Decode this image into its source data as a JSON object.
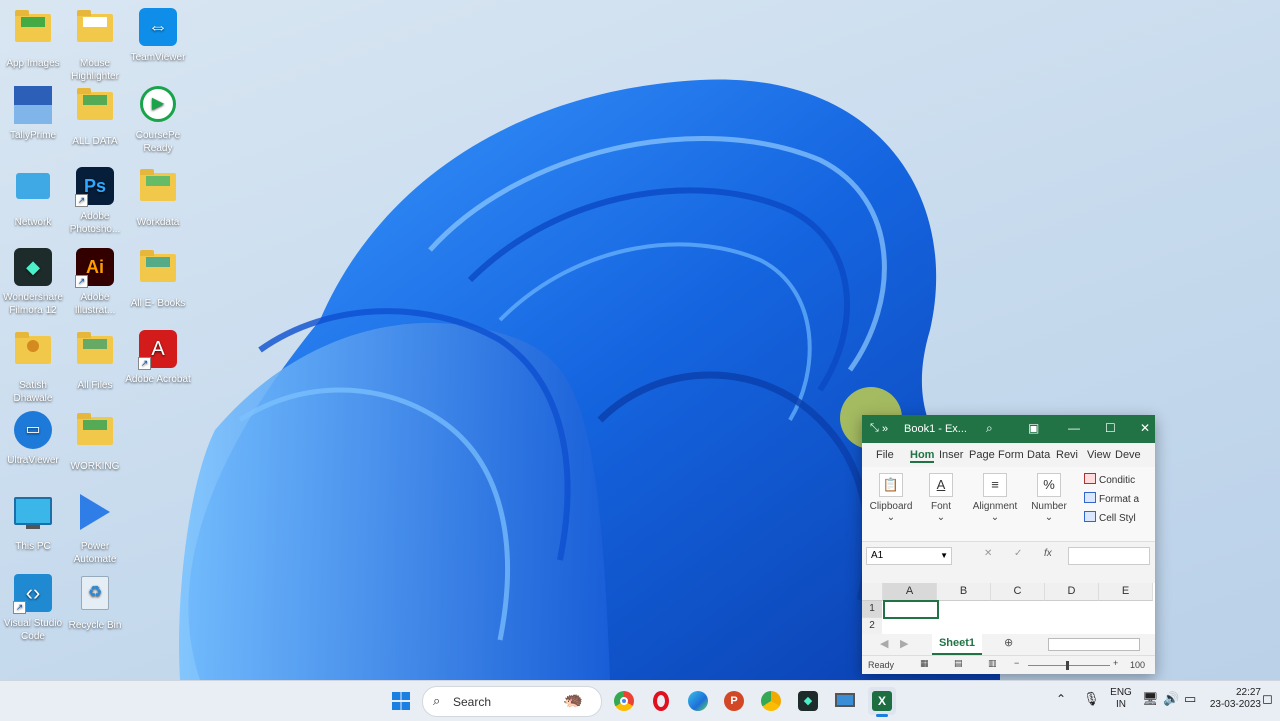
{
  "desktop": {
    "icons": [
      {
        "label": "App Images",
        "icon": "folder-icon"
      },
      {
        "label": "Mouse Highlighter",
        "icon": "folder-icon"
      },
      {
        "label": "TeamViewer",
        "icon": "teamviewer-icon"
      },
      {
        "label": "TallyPrime",
        "icon": "tallyprime-icon"
      },
      {
        "label": "ALL DATA",
        "icon": "folder-icon"
      },
      {
        "label": "CoursePe Ready",
        "icon": "coursepe-icon"
      },
      {
        "label": "Network",
        "icon": "network-icon"
      },
      {
        "label": "Adobe Photosho...",
        "icon": "photoshop-icon"
      },
      {
        "label": "Workdata",
        "icon": "folder-icon"
      },
      {
        "label": "Wondershare Filmora 12",
        "icon": "filmora-icon"
      },
      {
        "label": "Adobe Illustrat...",
        "icon": "illustrator-icon"
      },
      {
        "label": "All E- Books",
        "icon": "folder-icon"
      },
      {
        "label": "Satish Dhawale",
        "icon": "user-folder-icon"
      },
      {
        "label": "All Files",
        "icon": "folder-icon"
      },
      {
        "label": "Adobe Acrobat",
        "icon": "acrobat-icon"
      },
      {
        "label": "UltraViewer",
        "icon": "ultraviewer-icon"
      },
      {
        "label": "WORKING",
        "icon": "folder-icon"
      },
      {
        "label": "This PC",
        "icon": "monitor-icon"
      },
      {
        "label": "Power Automate",
        "icon": "power-automate-icon"
      },
      {
        "label": "Visual Studio Code",
        "icon": "vscode-icon"
      },
      {
        "label": "Recycle Bin",
        "icon": "recycle-bin-icon"
      }
    ]
  },
  "excel": {
    "title": "Book1 - Ex...",
    "tabs": [
      "File",
      "Hom",
      "Inser",
      "Page",
      "Form",
      "Data",
      "Revi",
      "View",
      "Deve"
    ],
    "groups": [
      "Clipboard",
      "Font",
      "Alignment",
      "Number"
    ],
    "number_symbol": "%",
    "styles": [
      "Conditic",
      "Format a",
      "Cell Styl"
    ],
    "namebox": "A1",
    "fx": "fx",
    "columns": [
      "A",
      "B",
      "C",
      "D",
      "E"
    ],
    "rows": [
      "1",
      "2"
    ],
    "sheet_tab": "Sheet1",
    "status": "Ready",
    "zoom": "100"
  },
  "taskbar": {
    "search_placeholder": "Search",
    "language": "ENG",
    "region": "IN",
    "time": "22:27",
    "date": "23-03-2023"
  },
  "colors": {
    "excel_green": "#217346",
    "wallpaper_blue": "#1a6fe0"
  }
}
